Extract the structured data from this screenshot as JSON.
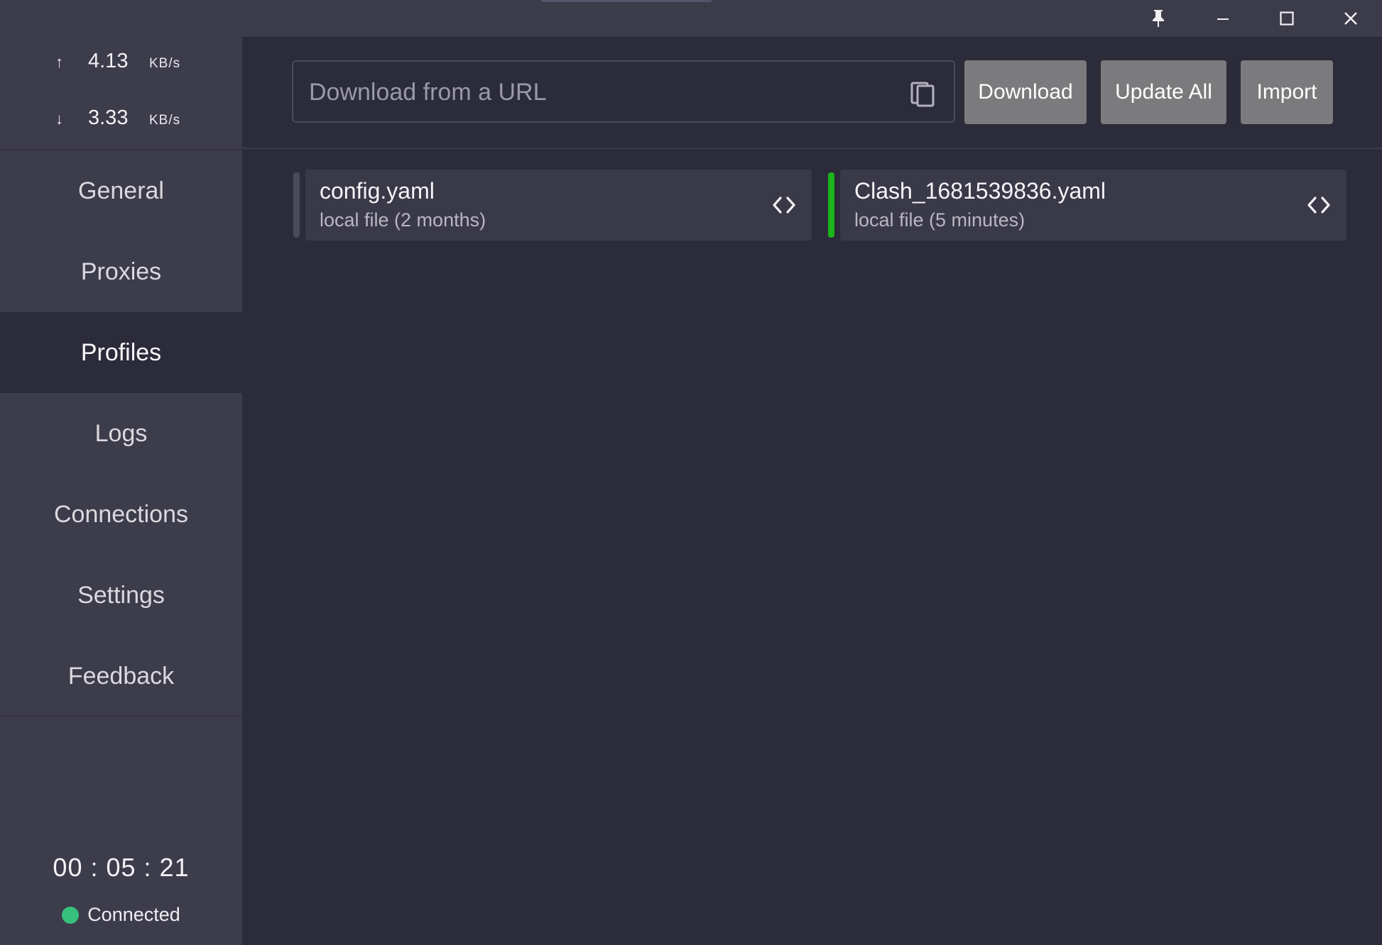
{
  "window": {
    "pin_icon": "pin-icon",
    "minimize_icon": "minimize-icon",
    "maximize_icon": "maximize-icon",
    "close_icon": "close-icon"
  },
  "sidebar": {
    "upload": {
      "arrow": "↑",
      "speed": "4.13",
      "unit": "KB/s"
    },
    "download": {
      "arrow": "↓",
      "speed": "3.33",
      "unit": "KB/s"
    },
    "nav": [
      {
        "label": "General"
      },
      {
        "label": "Proxies"
      },
      {
        "label": "Profiles",
        "active": true
      },
      {
        "label": "Logs"
      },
      {
        "label": "Connections"
      },
      {
        "label": "Settings"
      },
      {
        "label": "Feedback"
      }
    ],
    "timer": "00 : 05 : 21",
    "status": {
      "text": "Connected",
      "color": "#36c07c"
    }
  },
  "toolbar": {
    "url_placeholder": "Download from a URL",
    "url_value": "",
    "download_label": "Download",
    "update_all_label": "Update All",
    "import_label": "Import"
  },
  "profiles": [
    {
      "name": "config.yaml",
      "meta": "local file (2 months)",
      "selected": false,
      "indicator_color": "#4a4a58"
    },
    {
      "name": "Clash_1681539836.yaml",
      "meta": "local file (5 minutes)",
      "selected": true,
      "indicator_color": "#19b51b"
    }
  ],
  "colors": {
    "background": "#2c2b3a",
    "sidebar": "#3d3c4b",
    "card": "#3a3948",
    "button": "#7b7b7e",
    "accent_green": "#19b51b"
  }
}
